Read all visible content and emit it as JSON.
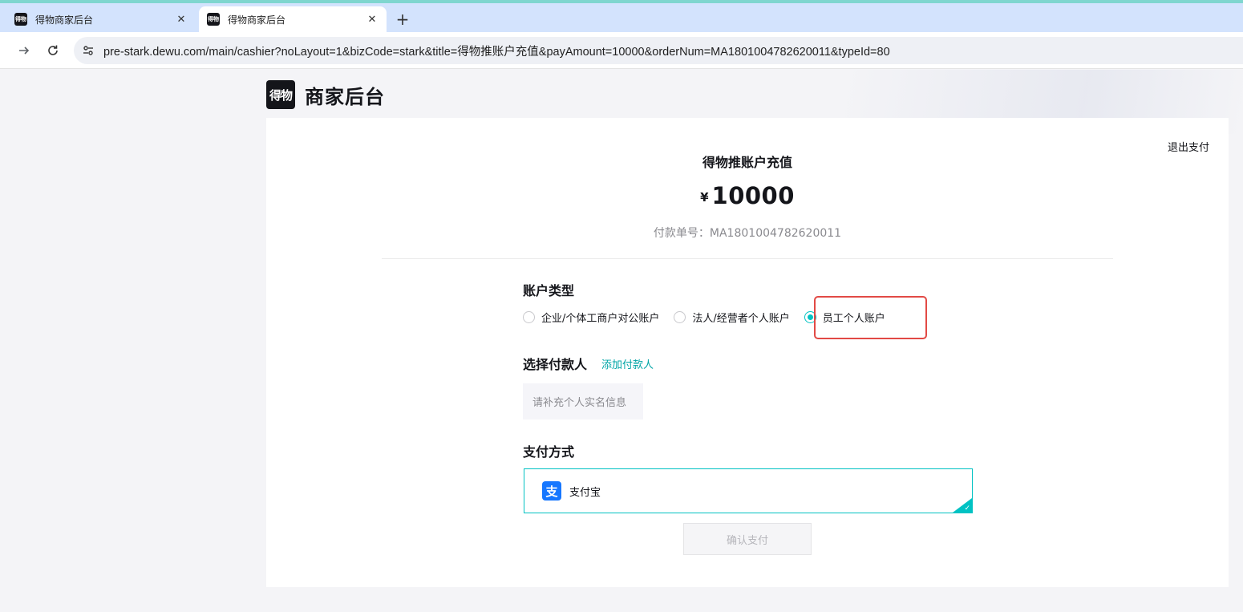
{
  "browser": {
    "tabs": [
      {
        "title": "得物商家后台",
        "favicon": "得物",
        "active": false
      },
      {
        "title": "得物商家后台",
        "favicon": "得物",
        "active": true
      }
    ],
    "close_glyph": "✕",
    "new_tab_glyph": "+",
    "url": "pre-stark.dewu.com/main/cashier?noLayout=1&bizCode=stark&title=得物推账户充值&payAmount=10000&orderNum=MA1801004782620011&typeId=80"
  },
  "header": {
    "logo_mark": "得物",
    "logo_text": "商家后台"
  },
  "cashier": {
    "exit_label": "退出支付",
    "title": "得物推账户充值",
    "currency": "¥",
    "amount": "10000",
    "order_line": "付款单号：MA1801004782620011"
  },
  "account_type": {
    "label": "账户类型",
    "options": [
      {
        "label": "企业/个体工商户对公账户",
        "checked": false
      },
      {
        "label": "法人/经营者个人账户",
        "checked": false
      },
      {
        "label": "员工个人账户",
        "checked": true
      }
    ]
  },
  "payer": {
    "label": "选择付款人",
    "add_label": "添加付款人",
    "input_placeholder": "请补充个人实名信息"
  },
  "payment_method": {
    "label": "支付方式",
    "options": [
      {
        "name": "支付宝",
        "icon": "alipay-icon",
        "selected": true
      }
    ]
  },
  "confirm_label": "确认支付",
  "colors": {
    "accent": "#01c2c3",
    "highlight": "#e24a45",
    "alipay": "#1677ff"
  }
}
